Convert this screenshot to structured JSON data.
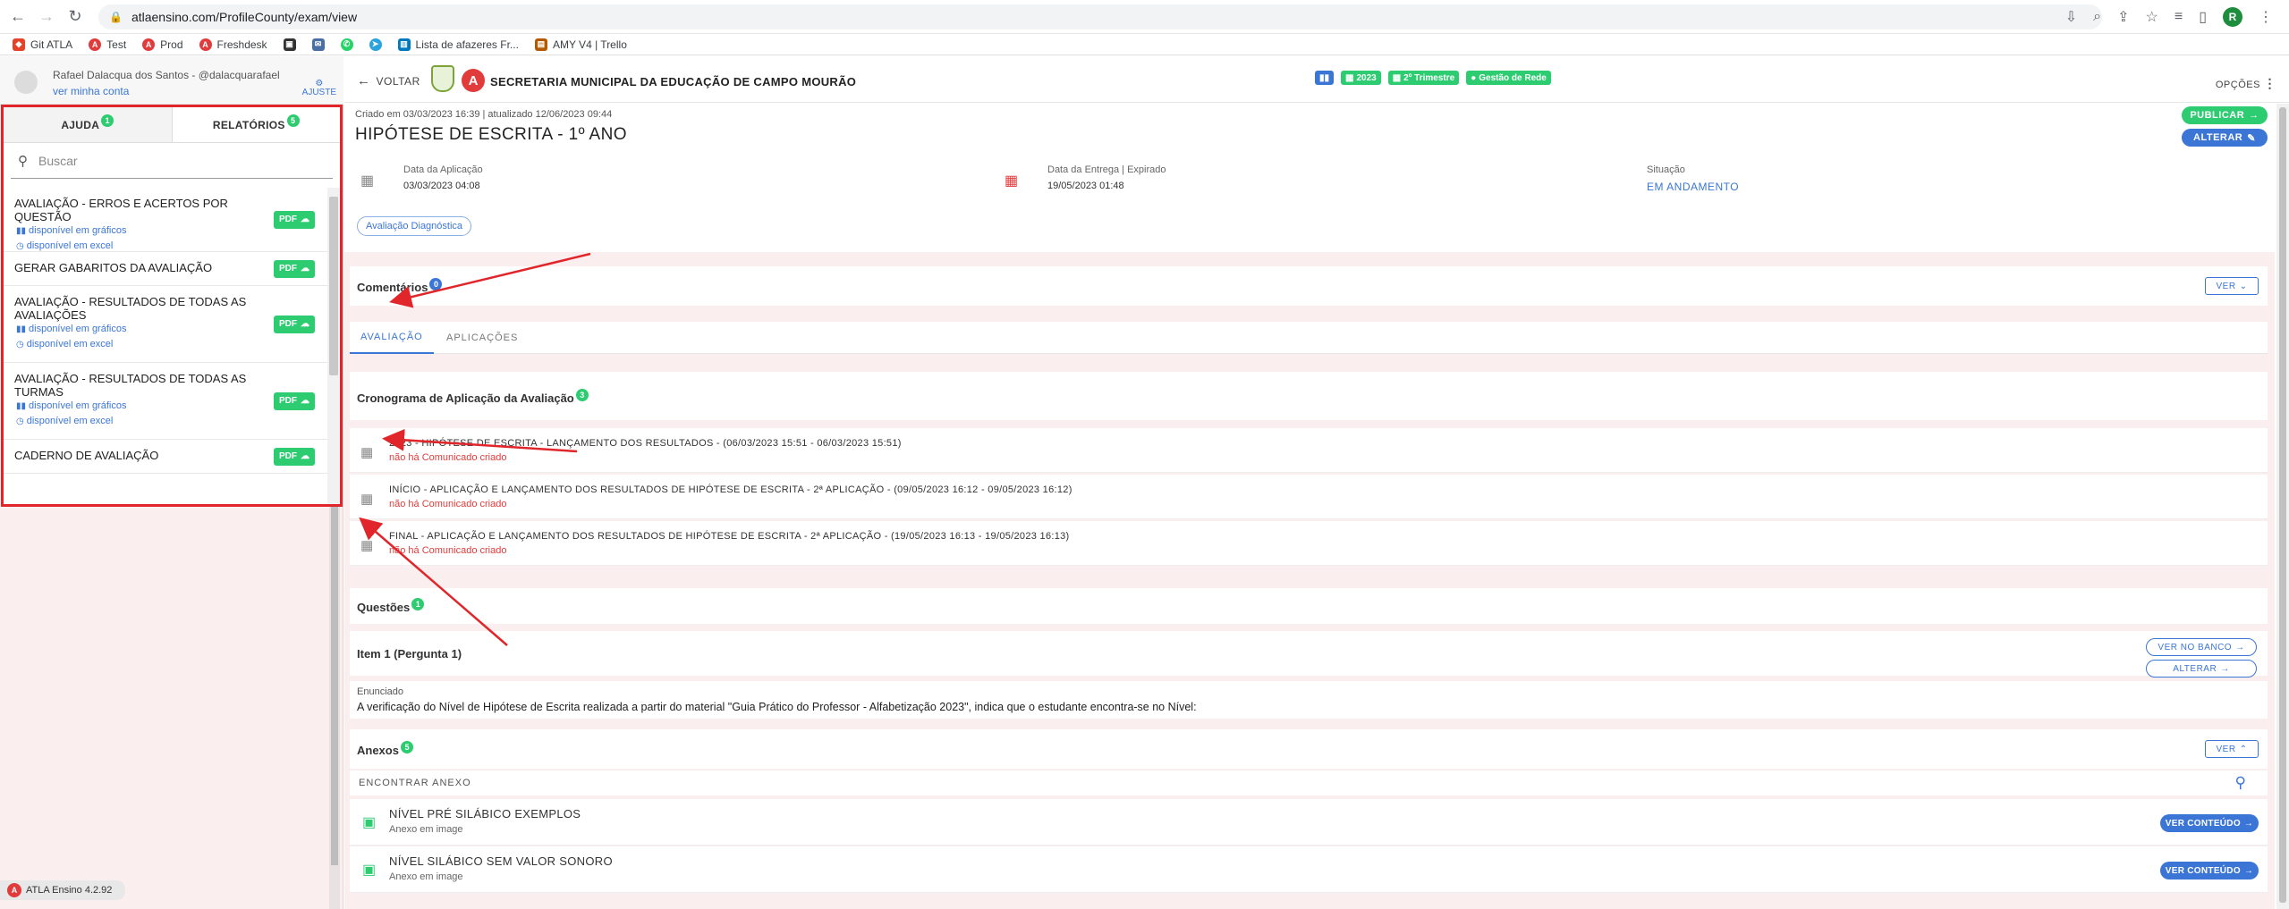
{
  "browser": {
    "url": "atlaensino.com/ProfileCounty/exam/view",
    "profile_initial": "R",
    "bookmarks": [
      {
        "label": "Git ATLA",
        "icon": "gitlab-icon",
        "color": "#e24329"
      },
      {
        "label": "Test",
        "icon": "atla-icon",
        "color": "#e23b3b"
      },
      {
        "label": "Prod",
        "icon": "atla-icon",
        "color": "#e23b3b"
      },
      {
        "label": "Freshdesk",
        "icon": "atla-icon",
        "color": "#e23b3b"
      },
      {
        "label": "",
        "icon": "app-icon",
        "color": "#333333"
      },
      {
        "label": "",
        "icon": "mail-icon",
        "color": "#4a6fa5"
      },
      {
        "label": "",
        "icon": "whatsapp-icon",
        "color": "#25d366"
      },
      {
        "label": "",
        "icon": "telegram-icon",
        "color": "#2aa3df"
      },
      {
        "label": "Lista de afazeres Fr...",
        "icon": "trello-icon",
        "color": "#0079bf"
      },
      {
        "label": "AMY V4 | Trello",
        "icon": "amy-icon",
        "color": "#b35900"
      }
    ]
  },
  "user": {
    "name": "Rafael Dalacqua dos Santos - @dalacquarafael",
    "link": "ver minha conta",
    "adjust": "AJUSTE"
  },
  "sidebar": {
    "tabs": [
      {
        "label": "AJUDA",
        "badge": "1"
      },
      {
        "label": "RELATÓRIOS",
        "badge": "5"
      }
    ],
    "search_placeholder": "Buscar",
    "reports": [
      {
        "title": "AVALIAÇÃO - ERROS E ACERTOS POR QUESTÃO",
        "subs": [
          "disponível em gráficos",
          "disponível em excel"
        ],
        "button": "PDF"
      },
      {
        "title": "GERAR GABARITOS DA AVALIAÇÃO",
        "subs": [],
        "button": "PDF"
      },
      {
        "title": "AVALIAÇÃO - RESULTADOS DE TODAS AS AVALIAÇÕES",
        "subs": [
          "disponível em gráficos",
          "disponível em excel"
        ],
        "button": "PDF"
      },
      {
        "title": "AVALIAÇÃO - RESULTADOS DE TODAS AS TURMAS",
        "subs": [
          "disponível em gráficos",
          "disponível em excel"
        ],
        "button": "PDF"
      },
      {
        "title": "CADERNO DE AVALIAÇÃO",
        "subs": [],
        "button": "PDF"
      }
    ],
    "version": "ATLA Ensino 4.2.92"
  },
  "header": {
    "back": "VOLTAR",
    "org": "SECRETARIA MUNICIPAL DA EDUCAÇÃO DE CAMPO MOURÃO",
    "chips": [
      "2023",
      "2º Trimestre",
      "Gestão de Rede"
    ],
    "options": "OPÇÕES"
  },
  "exam": {
    "created": "Criado em 03/03/2023 16:39 | atualizado 12/06/2023 09:44",
    "title": "HIPÓTESE DE ESCRITA - 1º ANO",
    "publish": "PUBLICAR",
    "edit": "ALTERAR",
    "application_label": "Data da Aplicação",
    "application_value": "03/03/2023 04:08",
    "delivery_label": "Data da Entrega | Expirado",
    "delivery_value": "19/05/2023 01:48",
    "status_label": "Situação",
    "status_value": "EM ANDAMENTO",
    "tag": "Avaliação Diagnóstica"
  },
  "comments": {
    "title": "Comentários",
    "badge": "0",
    "button": "VER"
  },
  "subtabs": [
    "AVALIAÇÃO",
    "APLICAÇÕES"
  ],
  "schedule": {
    "title": "Cronograma de Aplicação da Avaliação",
    "badge": "3",
    "items": [
      {
        "text": "2023 - HIPÓTESE DE ESCRITA - LANÇAMENTO DOS RESULTADOS - (06/03/2023 15:51 - 06/03/2023 15:51)",
        "status": "não há Comunicado criado"
      },
      {
        "text": "INÍCIO - APLICAÇÃO E LANÇAMENTO DOS RESULTADOS DE HIPÓTESE DE ESCRITA - 2ª APLICAÇÃO - (09/05/2023 16:12 - 09/05/2023 16:12)",
        "status": "não há Comunicado criado"
      },
      {
        "text": "FINAL - APLICAÇÃO E LANÇAMENTO DOS RESULTADOS DE HIPÓTESE DE ESCRITA - 2ª APLICAÇÃO - (19/05/2023 16:13 - 19/05/2023 16:13)",
        "status": "não há Comunicado criado"
      }
    ]
  },
  "questions": {
    "title": "Questões",
    "badge": "1",
    "item_title": "Item 1 (Pergunta 1)",
    "bank_button": "VER NO BANCO",
    "edit_button": "ALTERAR",
    "statement_label": "Enunciado",
    "statement": "A verificação do Nível de Hipótese de Escrita realizada a partir do material \"Guia Prático do Professor - Alfabetização 2023\", indica que o estudante encontra-se no Nível:"
  },
  "annexes": {
    "title": "Anexos",
    "badge": "5",
    "button": "VER",
    "find": "ENCONTRAR ANEXO",
    "items": [
      {
        "title": "NÍVEL PRÉ SILÁBICO EXEMPLOS",
        "sub": "Anexo em image",
        "button": "VER CONTEÚDO"
      },
      {
        "title": "NÍVEL SILÁBICO SEM VALOR SONORO",
        "sub": "Anexo em image",
        "button": "VER CONTEÚDO"
      }
    ]
  },
  "colors": {
    "accent_blue": "#3b76d6",
    "green": "#2ecc71",
    "red": "#e23b3b",
    "highlight": "#e0262b"
  }
}
